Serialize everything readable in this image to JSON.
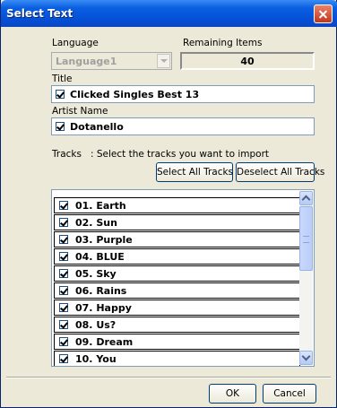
{
  "window": {
    "title": "Select Text"
  },
  "language": {
    "label": "Language",
    "value": "Language1"
  },
  "remaining": {
    "label": "Remaining Items",
    "value": "40"
  },
  "title_field": {
    "label": "Title",
    "value": "Clicked Singles Best 13",
    "checked": true
  },
  "artist_field": {
    "label": "Artist Name",
    "value": "Dotanello",
    "checked": true
  },
  "tracks": {
    "label": "Tracks",
    "instruction": ": Select the tracks you want to import",
    "select_all": "Select All Tracks",
    "deselect_all": "Deselect All Tracks",
    "items": [
      {
        "label": "01. Earth",
        "checked": true
      },
      {
        "label": "02. Sun",
        "checked": true
      },
      {
        "label": "03. Purple",
        "checked": true
      },
      {
        "label": "04. BLUE",
        "checked": true
      },
      {
        "label": "05. Sky",
        "checked": true
      },
      {
        "label": "06. Rains",
        "checked": true
      },
      {
        "label": "07. Happy",
        "checked": true
      },
      {
        "label": "08. Us?",
        "checked": true
      },
      {
        "label": "09. Dream",
        "checked": true
      },
      {
        "label": "10. You",
        "checked": true
      }
    ]
  },
  "footer": {
    "ok": "OK",
    "cancel": "Cancel"
  }
}
